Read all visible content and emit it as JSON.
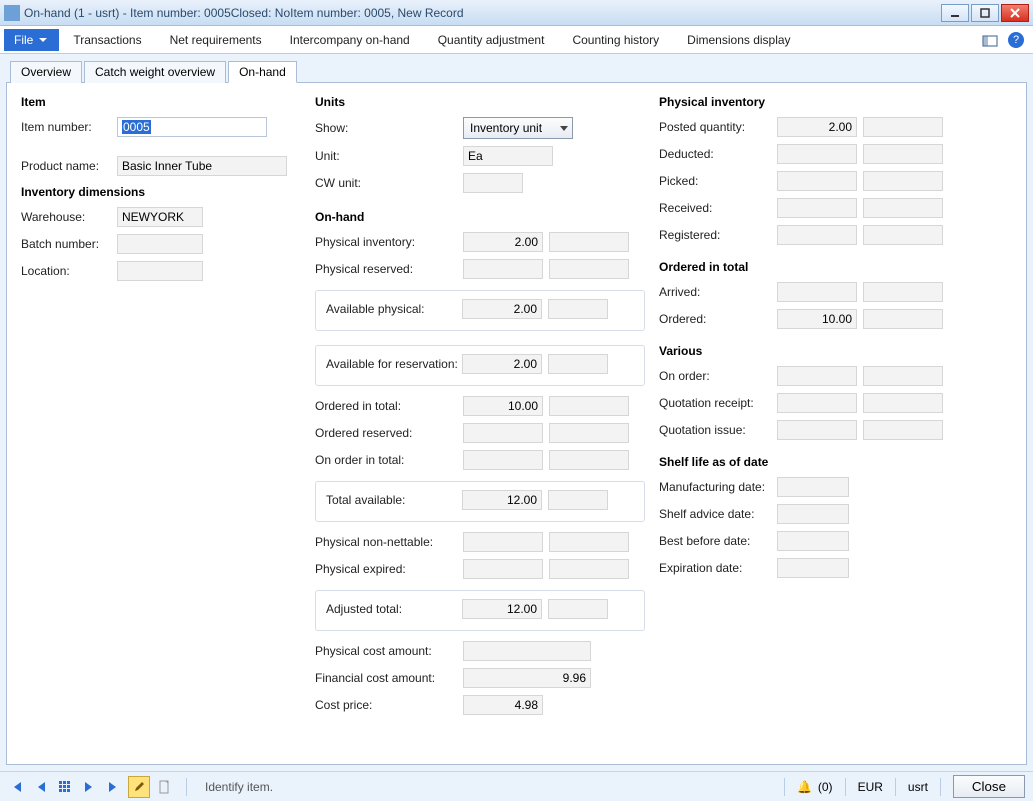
{
  "window": {
    "title": "On-hand (1 - usrt) - Item number: 0005Closed: NoItem number: 0005, New Record"
  },
  "menu": {
    "file": "File",
    "items": [
      "Transactions",
      "Net requirements",
      "Intercompany on-hand",
      "Quantity adjustment",
      "Counting history",
      "Dimensions display"
    ]
  },
  "tabs": {
    "overview": "Overview",
    "cw_overview": "Catch weight overview",
    "onhand": "On-hand"
  },
  "item": {
    "header": "Item",
    "item_number_label": "Item number:",
    "item_number_value": "0005",
    "product_name_label": "Product name:",
    "product_name_value": "Basic Inner Tube",
    "inv_dim_header": "Inventory dimensions",
    "warehouse_label": "Warehouse:",
    "warehouse_value": "NEWYORK",
    "batch_label": "Batch number:",
    "batch_value": "",
    "location_label": "Location:",
    "location_value": ""
  },
  "units": {
    "header": "Units",
    "show_label": "Show:",
    "show_value": "Inventory unit",
    "unit_label": "Unit:",
    "unit_value": "Ea",
    "cw_unit_label": "CW unit:",
    "cw_unit_value": ""
  },
  "onhand": {
    "header": "On-hand",
    "phys_inv_label": "Physical inventory:",
    "phys_inv_value": "2.00",
    "phys_res_label": "Physical reserved:",
    "phys_res_value": "",
    "avail_phys_label": "Available physical:",
    "avail_phys_value": "2.00",
    "avail_res_label": "Available for reservation:",
    "avail_res_value": "2.00",
    "ordered_total_label": "Ordered in total:",
    "ordered_total_value": "10.00",
    "ordered_res_label": "Ordered reserved:",
    "ordered_res_value": "",
    "on_order_total_label": "On order in total:",
    "on_order_total_value": "",
    "total_avail_label": "Total available:",
    "total_avail_value": "12.00",
    "phys_nonnet_label": "Physical non-nettable:",
    "phys_nonnet_value": "",
    "phys_exp_label": "Physical expired:",
    "phys_exp_value": "",
    "adj_total_label": "Adjusted total:",
    "adj_total_value": "12.00",
    "phys_cost_label": "Physical cost amount:",
    "phys_cost_value": "",
    "fin_cost_label": "Financial cost amount:",
    "fin_cost_value": "9.96",
    "cost_price_label": "Cost price:",
    "cost_price_value": "4.98"
  },
  "phys_inv": {
    "header": "Physical inventory",
    "posted_label": "Posted quantity:",
    "posted_value": "2.00",
    "deducted_label": "Deducted:",
    "deducted_value": "",
    "picked_label": "Picked:",
    "picked_value": "",
    "received_label": "Received:",
    "received_value": "",
    "registered_label": "Registered:",
    "registered_value": ""
  },
  "ordered_total": {
    "header": "Ordered in total",
    "arrived_label": "Arrived:",
    "arrived_value": "",
    "ordered_label": "Ordered:",
    "ordered_value": "10.00"
  },
  "various": {
    "header": "Various",
    "on_order_label": "On order:",
    "on_order_value": "",
    "quo_receipt_label": "Quotation receipt:",
    "quo_receipt_value": "",
    "quo_issue_label": "Quotation issue:",
    "quo_issue_value": ""
  },
  "shelf": {
    "header": "Shelf life as of date",
    "mfg_label": "Manufacturing date:",
    "mfg_value": "",
    "advice_label": "Shelf advice date:",
    "advice_value": "",
    "best_label": "Best before date:",
    "best_value": "",
    "exp_label": "Expiration date:",
    "exp_value": ""
  },
  "status": {
    "help": "Identify item.",
    "bell_count": "(0)",
    "currency": "EUR",
    "user": "usrt",
    "close": "Close"
  }
}
